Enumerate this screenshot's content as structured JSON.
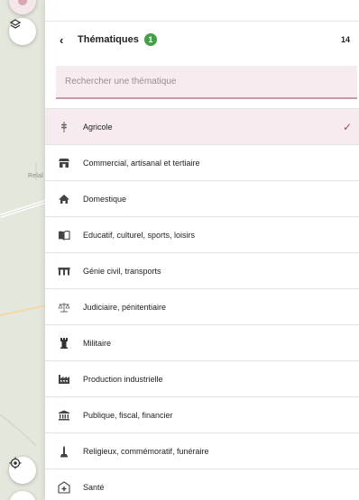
{
  "map": {
    "place_label": "Relal"
  },
  "header": {
    "title": "Thématiques",
    "selected_count": "1",
    "total_count": "14"
  },
  "search": {
    "placeholder": "Rechercher une thématique",
    "value": ""
  },
  "items": [
    {
      "label": "Agricole",
      "icon": "wheat-icon",
      "selected": true
    },
    {
      "label": "Commercial, artisanal et tertiaire",
      "icon": "shop-icon",
      "selected": false
    },
    {
      "label": "Domestique",
      "icon": "house-icon",
      "selected": false
    },
    {
      "label": "Educatif, culturel, sports, loisirs",
      "icon": "book-icon",
      "selected": false
    },
    {
      "label": "Génie civil, transports",
      "icon": "bridge-icon",
      "selected": false
    },
    {
      "label": "Judiciaire, pénitentiaire",
      "icon": "scales-icon",
      "selected": false
    },
    {
      "label": "Militaire",
      "icon": "tower-icon",
      "selected": false
    },
    {
      "label": "Production industrielle",
      "icon": "factory-icon",
      "selected": false
    },
    {
      "label": "Publique, fiscal, financier",
      "icon": "bank-icon",
      "selected": false
    },
    {
      "label": "Religieux, commémoratif, funéraire",
      "icon": "monument-icon",
      "selected": false
    },
    {
      "label": "Santé",
      "icon": "hospital-icon",
      "selected": false
    }
  ],
  "colors": {
    "accent": "#a04a5f",
    "badge": "#43a047",
    "selected_bg": "#f6ecef"
  }
}
